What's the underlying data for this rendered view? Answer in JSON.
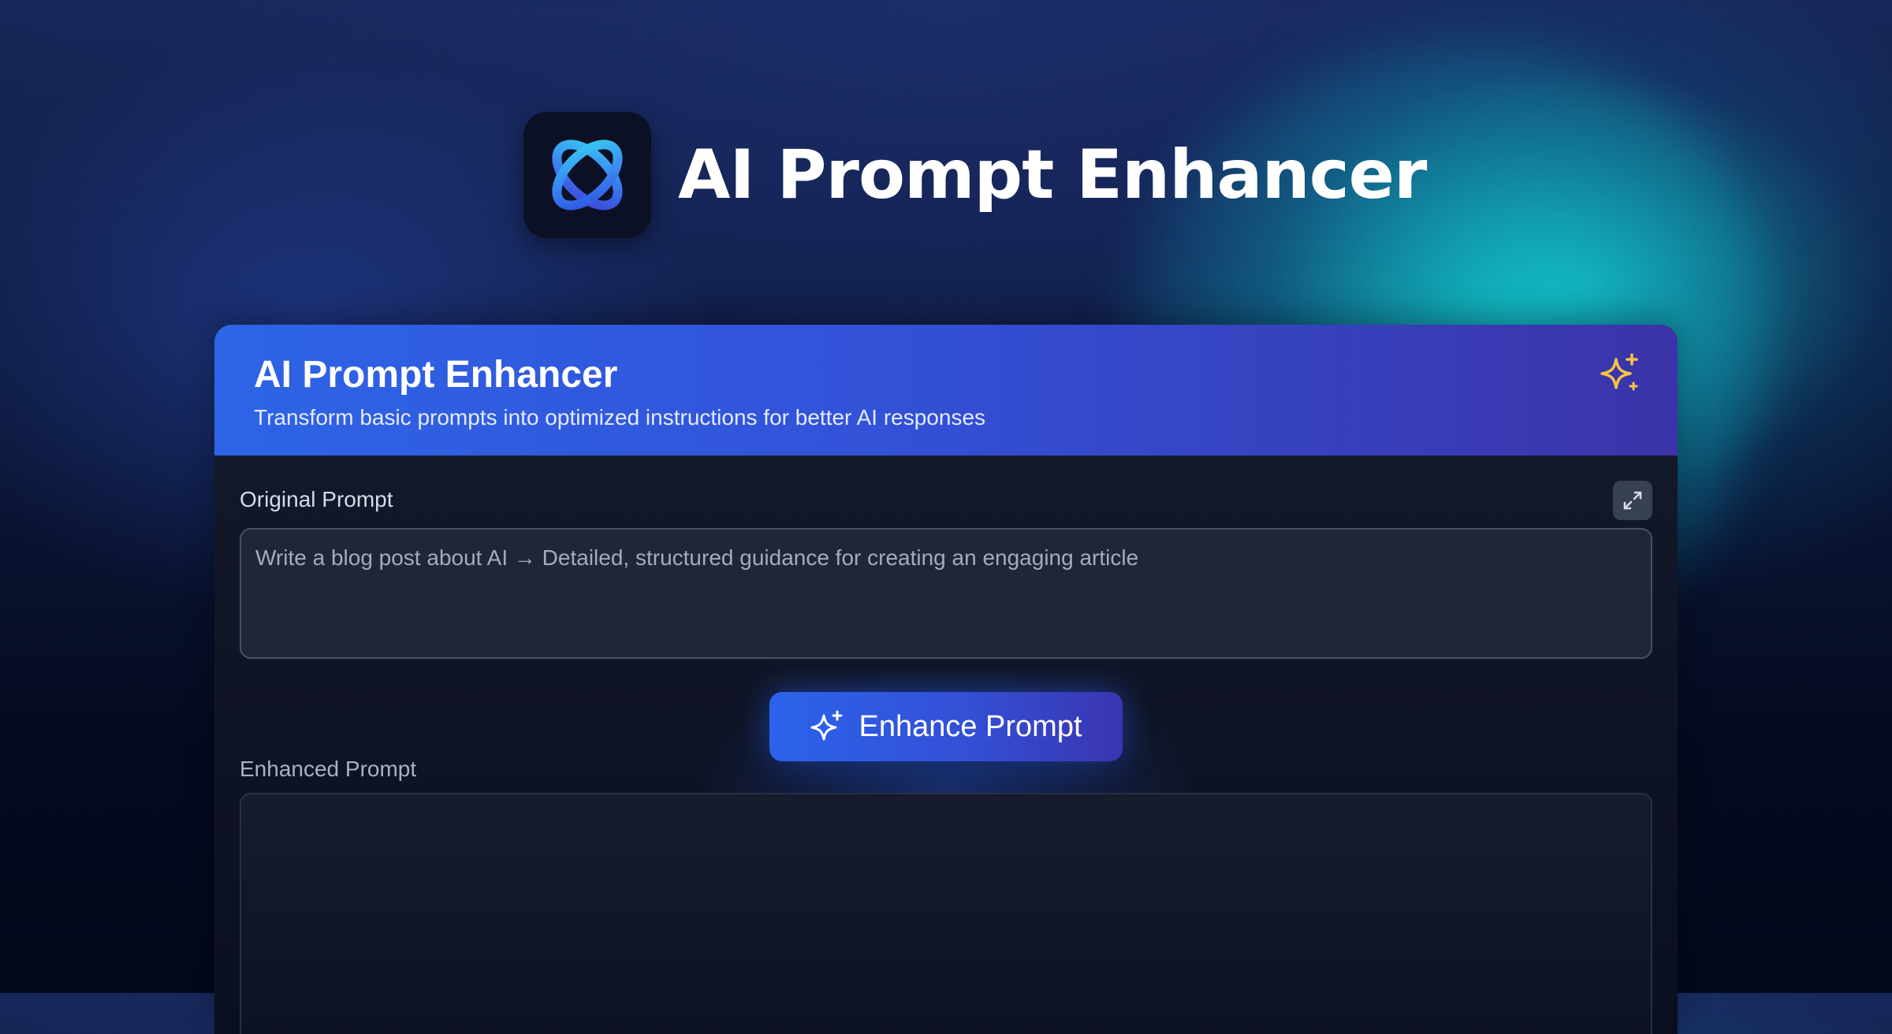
{
  "hero": {
    "title": "AI Prompt Enhancer",
    "logo_icon": "orbit-logo-icon"
  },
  "card": {
    "title": "AI Prompt Enhancer",
    "subtitle": "Transform basic prompts into optimized instructions for better AI responses",
    "header_icon": "sparkle-icon",
    "original": {
      "label": "Original Prompt",
      "placeholder": "Write a blog post about AI → Detailed, structured guidance for creating an engaging article",
      "value": ""
    },
    "expand_icon": "expand-icon",
    "enhance_button": {
      "label": "Enhance Prompt",
      "icon": "sparkle-icon"
    },
    "enhanced": {
      "label": "Enhanced Prompt",
      "value": ""
    }
  },
  "colors": {
    "accent_blue": "#2e64e6",
    "accent_indigo": "#3b33a8",
    "sparkle_yellow": "#f5c542",
    "teal_glow": "#14c8cd"
  }
}
